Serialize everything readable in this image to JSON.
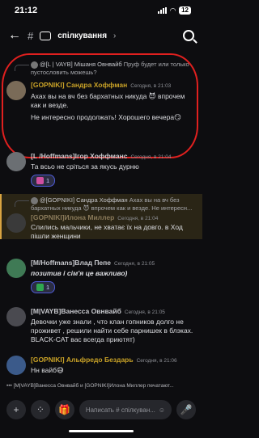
{
  "status": {
    "time": "21:12",
    "battery": "12"
  },
  "header": {
    "title": "спілкування",
    "chevron": "›"
  },
  "messages": [
    {
      "reply": {
        "author": "@[L | VAYB] Мішаня Овнвайб",
        "text": "Пруф будет или только пустословить можешь?"
      },
      "author": "[GOPNIKI] Сандра Хоффман",
      "author_color": "#c9a227",
      "time": "Сегодня, в 21:03",
      "text1": "Ахах  вы на вч без бархатных никуда 😈  впрочем как и везде.",
      "text2": "Не интересно продолжать! Хорошего вечера😏"
    },
    {
      "author": "[L /Hoffmans]Ігор Хоффманс",
      "author_color": "#c8c9ce",
      "time": "Сегодня, в 21:04",
      "text1": "Та всьо не сріться за якусь дурню",
      "reaction_count": "1"
    },
    {
      "reply": {
        "author": "@[GOPNIKI] Сандра Хоффман",
        "text": "Ахах  вы на вч без бархатных никуда 😈  впрочем как и везде. Не интересн..."
      },
      "author": "[GOPNIKI]Илона Миллер",
      "author_color": "#8a7a5a",
      "time": "Сегодня, в 21:04",
      "text1": "Слились мальчики, не хватає їх на довго. в Ход пішли женщини"
    },
    {
      "author": "[M/Hoffmans]Влад Пепе",
      "author_color": "#c8c9ce",
      "time": "Сегодня, в 21:05",
      "text1": "позитив і сім'я це важливо)",
      "reaction_count": "1"
    },
    {
      "author": "[M|VAYB]Ванесса Овнвайб",
      "author_color": "#c8c9ce",
      "time": "Сегодня, в 21:05",
      "text1": "Девочки уже знали , что клан гопников долго не проживет , решили найти себе парнишек в блэках. BLACK-CAT вас всегда приютят)"
    },
    {
      "author": "[GOPNIKI] Альфредо Бездарь",
      "author_color": "#c9a227",
      "time": "Сегодня, в 21:06",
      "text1": "Нн вайб😅"
    }
  ],
  "typing": "[M|VAYB]Ванесса Овнвайб и [GOPNIKI]Илона Миллер печатают...",
  "composer": {
    "placeholder": "Написать #  спілкуван..."
  },
  "colors": {
    "accent": "#4e5bd6",
    "highlight_border": "#d9a441",
    "annotation": "#e0201f"
  }
}
